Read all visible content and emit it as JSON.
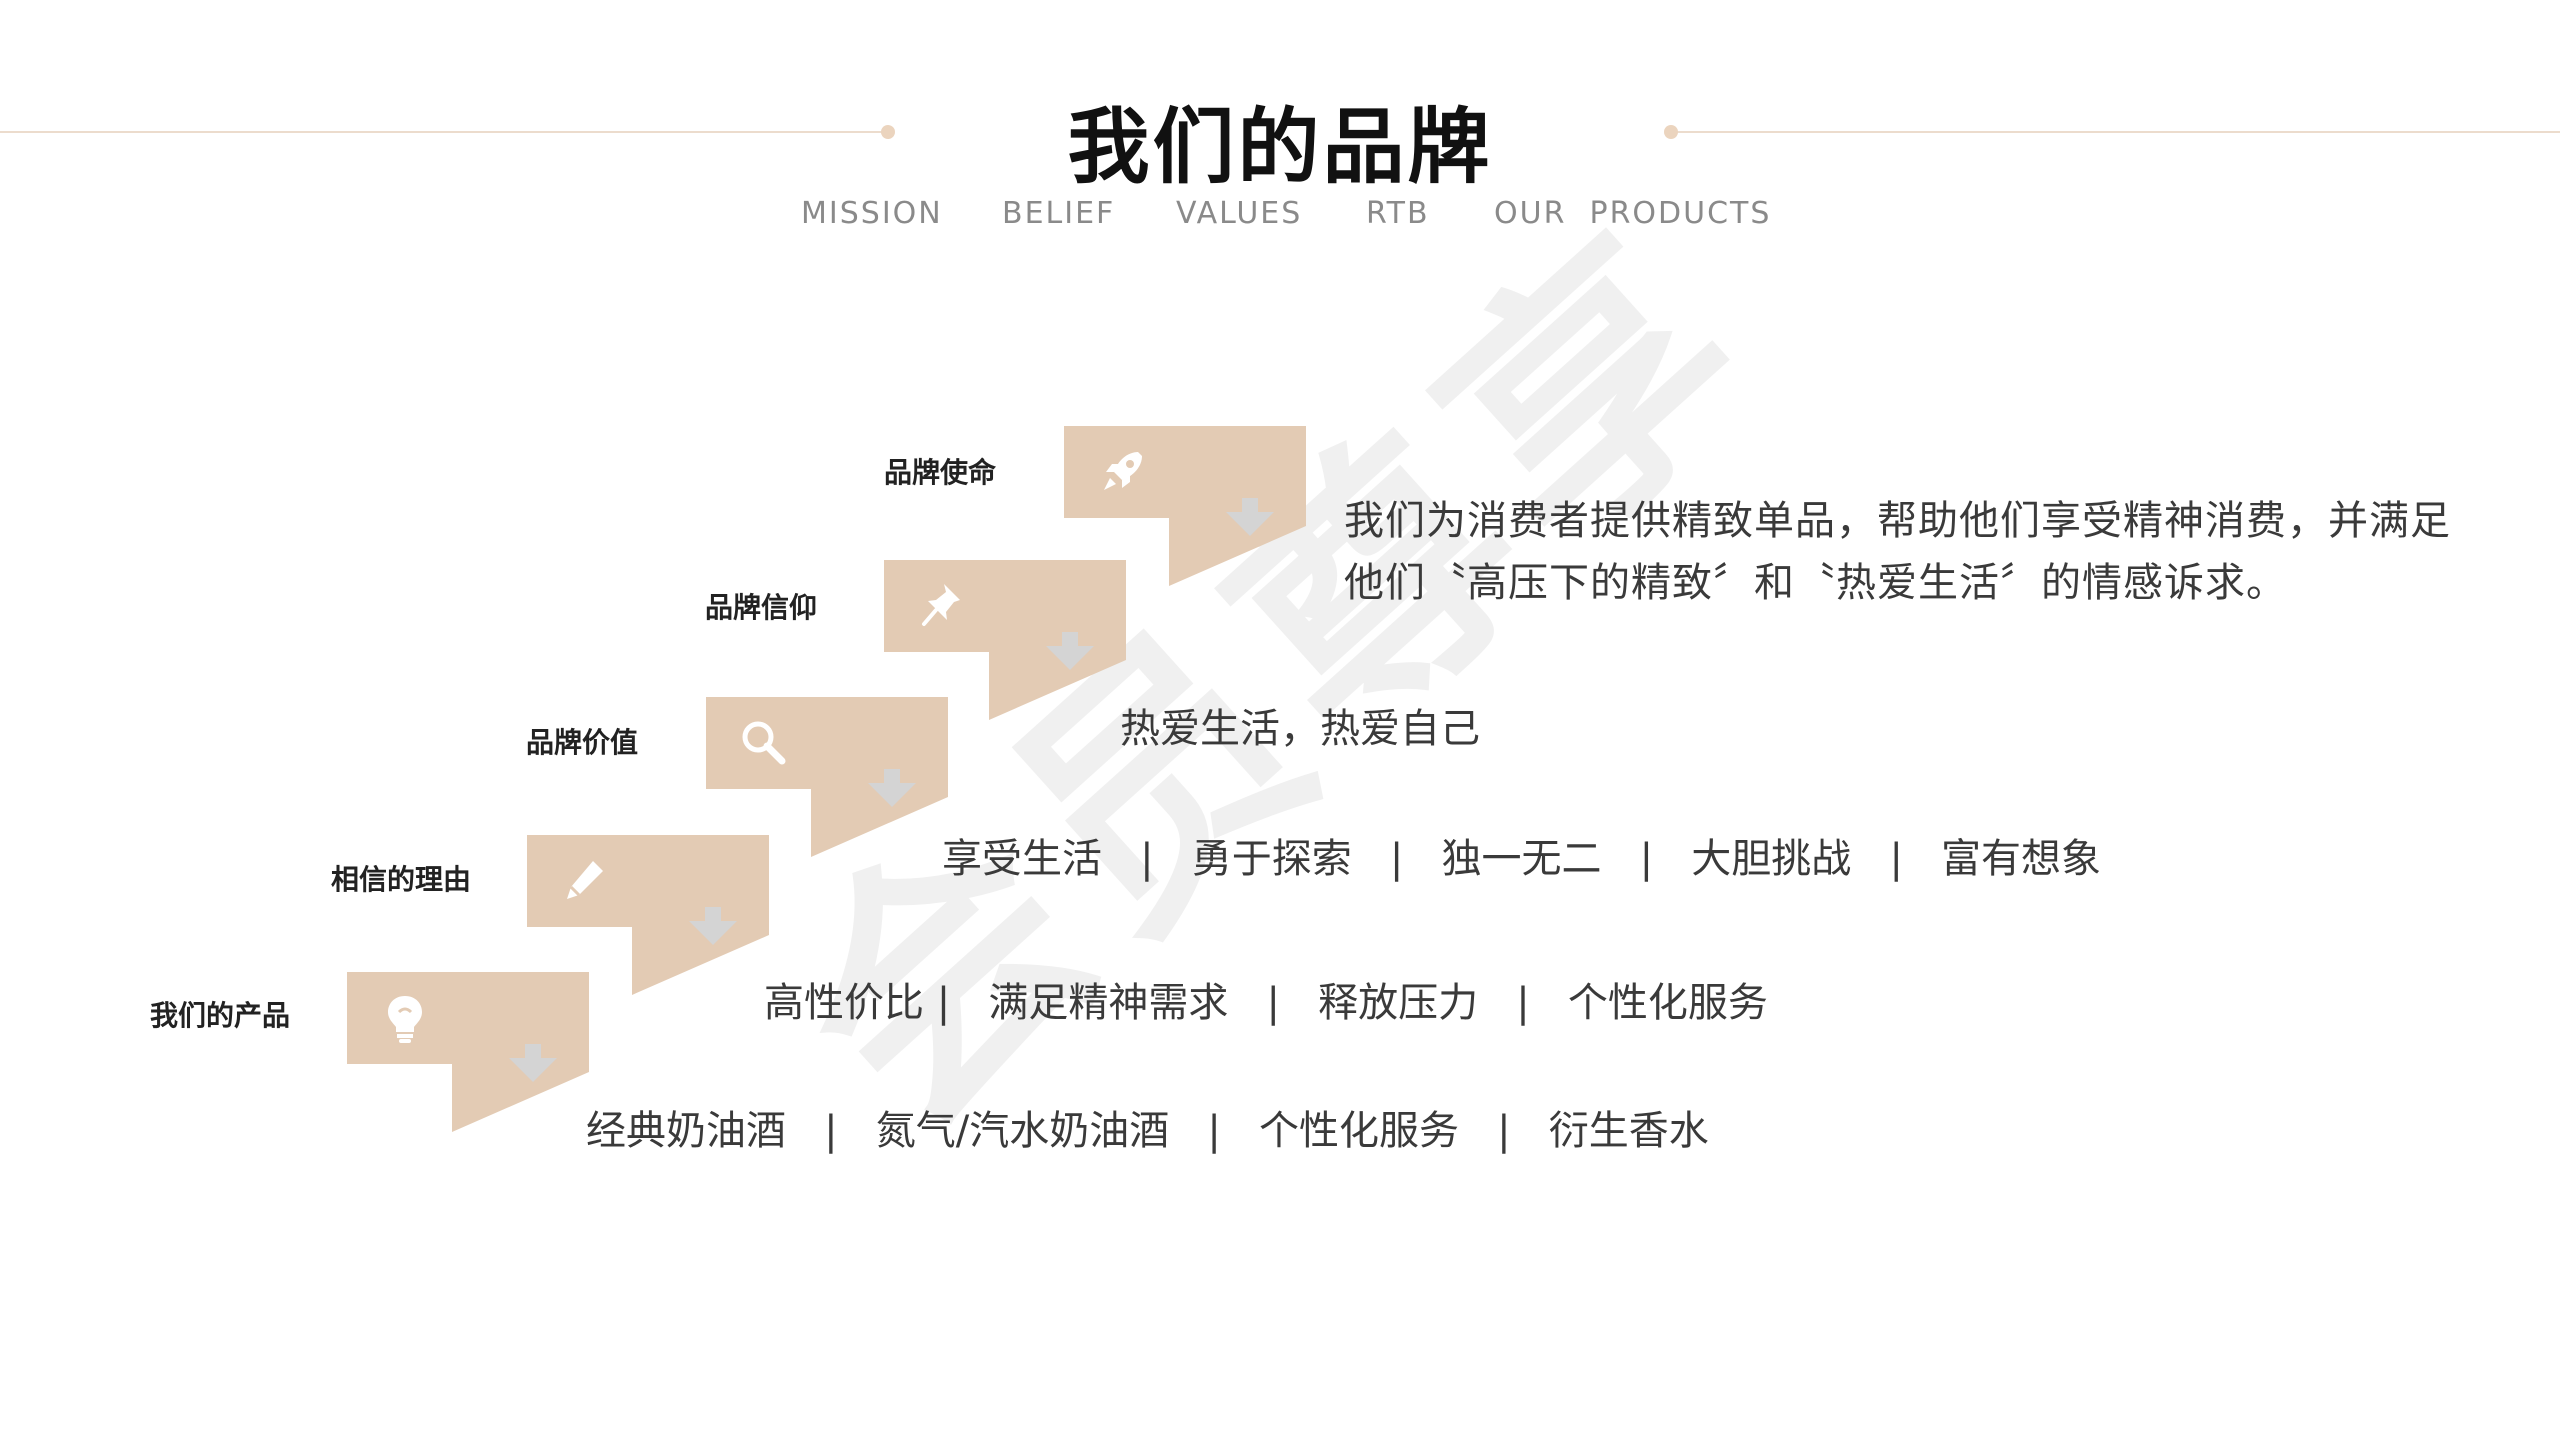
{
  "header": {
    "title": "我们的品牌",
    "nav": [
      "MISSION",
      "BELIEF",
      "VALUES",
      "RTB",
      "OUR  PRODUCTS"
    ]
  },
  "watermark": "会员尊享",
  "colors": {
    "accent": "#e3cbb4",
    "arrow": "#d4d4d4",
    "line": "#ecdccd"
  },
  "steps": [
    {
      "label": "我们的产品",
      "icon": "lightbulb-icon",
      "text": "经典奶油酒   |   氮气/汽水奶油酒   |   个性化服务   |   衍生香水"
    },
    {
      "label": "相信的理由",
      "icon": "pencil-icon",
      "text": "高性价比 |   满足精神需求   |   释放压力   |   个性化服务"
    },
    {
      "label": "品牌价值",
      "icon": "search-icon",
      "text": "享受生活   |   勇于探索   |   独一无二   |   大胆挑战   |   富有想象"
    },
    {
      "label": "品牌信仰",
      "icon": "pushpin-icon",
      "text": "热爱生活，热爱自己"
    },
    {
      "label": "品牌使命",
      "icon": "rocket-icon",
      "text": "我们为消费者提供精致单品，帮助他们享受精神消费，并满足他们〝高压下的精致〞和〝热爱生活〞的情感诉求。"
    }
  ]
}
